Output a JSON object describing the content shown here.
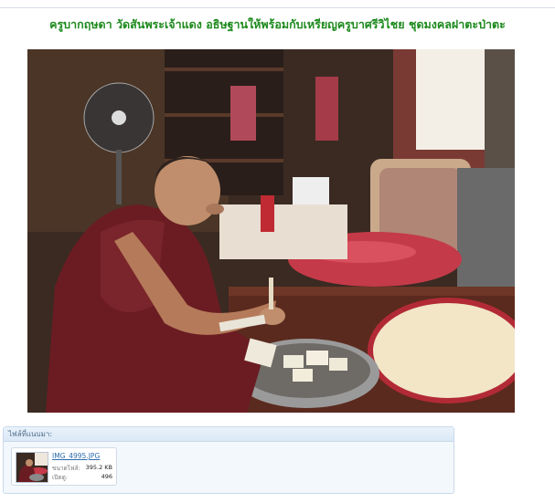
{
  "post": {
    "title": "ครูบากฤษดา วัดสันพระเจ้าแดง อธิษฐานให้พร้อมกับเหรียญครูบาศรีวิไชย ชุดมงคลฝาตะป่าตะ"
  },
  "attachments": {
    "header": "ไฟล์ที่แนบมา:",
    "items": [
      {
        "filename": "IMG_4995.JPG",
        "size_label": "ขนาดไฟล์:",
        "size_value": "395.2 KB",
        "views_label": "เปิดดู:",
        "views_value": "496"
      }
    ]
  },
  "colors": {
    "title_green": "#1d8a1d",
    "link_blue": "#2d6aad",
    "panel_border": "#c9d9ea",
    "robe_maroon": "#6b1c22"
  },
  "icons": {
    "attachment_thumbnail": "photo-thumbnail-icon"
  }
}
